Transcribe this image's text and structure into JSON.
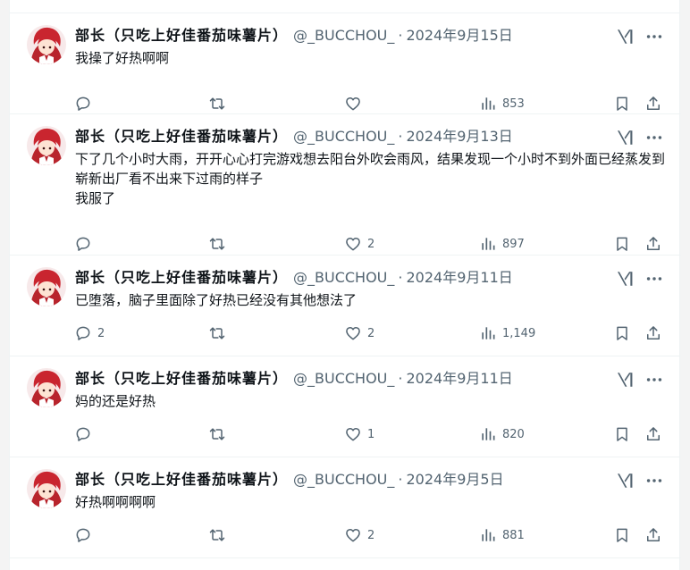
{
  "account": {
    "name": "部长（只吃上好佳番茄味薯片）",
    "handle": "@_BUCCHOU_"
  },
  "tweets": [
    {
      "date": "2024年9月15日",
      "text": "我操了好热啊啊",
      "replies": "",
      "retweets": "",
      "likes": "",
      "views": "853"
    },
    {
      "date": "2024年9月13日",
      "text": "下了几个小时大雨，开开心心打完游戏想去阳台外吹会雨风，结果发现一个小时不到外面已经蒸发到崭新出厂看不出来下过雨的样子\n我服了",
      "replies": "",
      "retweets": "",
      "likes": "2",
      "views": "897"
    },
    {
      "date": "2024年9月11日",
      "text": "已堕落，脑子里面除了好热已经没有其他想法了",
      "replies": "2",
      "retweets": "",
      "likes": "2",
      "views": "1,149"
    },
    {
      "date": "2024年9月11日",
      "text": "妈的还是好热",
      "replies": "",
      "retweets": "",
      "likes": "1",
      "views": "820"
    },
    {
      "date": "2024年9月5日",
      "text": "好热啊啊啊啊",
      "replies": "",
      "retweets": "",
      "likes": "2",
      "views": "881"
    }
  ],
  "icons": {
    "reply": "reply-icon",
    "retweet": "retweet-icon",
    "like": "heart-icon",
    "views": "views-icon",
    "bookmark": "bookmark-icon",
    "share": "share-icon",
    "grok": "grok-icon",
    "more": "more-icon"
  },
  "colors": {
    "text": "#0f1419",
    "secondary": "#536471",
    "divider": "#eff3f4",
    "side": "#f4f4f4"
  }
}
